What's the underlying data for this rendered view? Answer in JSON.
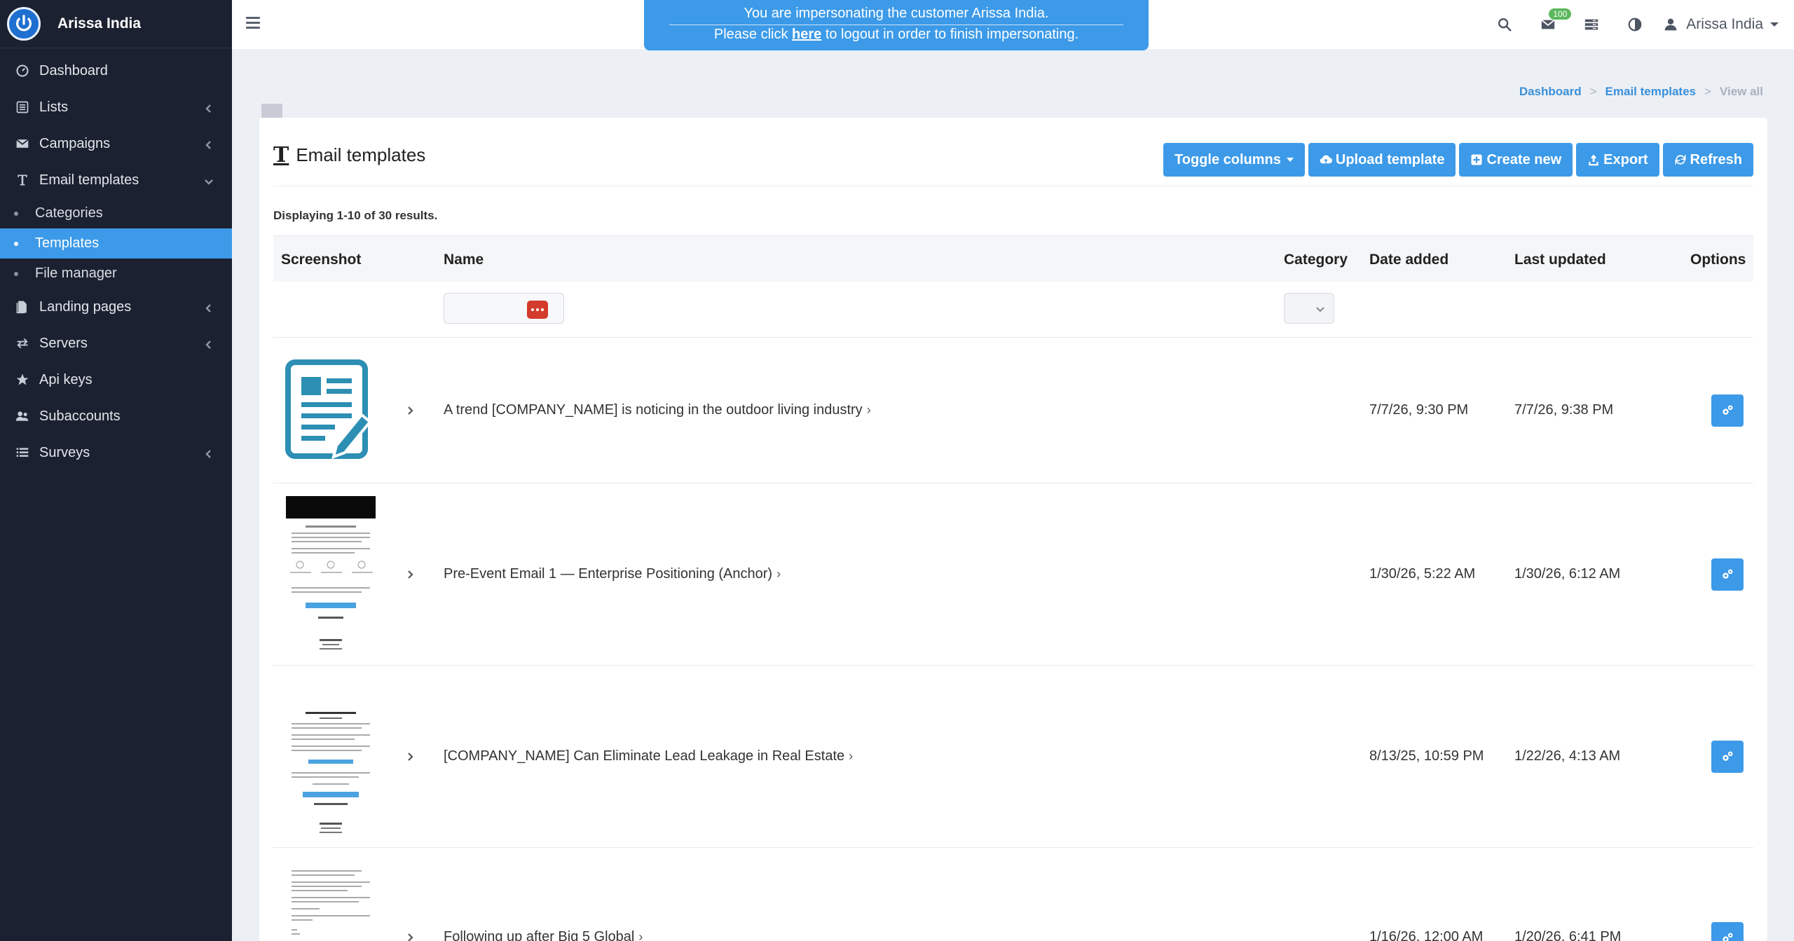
{
  "app": {
    "brand_name": "Arissa India"
  },
  "sidebar": {
    "items": [
      {
        "label": "Dashboard",
        "icon": "dashboard-icon"
      },
      {
        "label": "Lists",
        "icon": "list-icon"
      },
      {
        "label": "Campaigns",
        "icon": "envelope-icon"
      },
      {
        "label": "Email templates",
        "icon": "text-icon"
      },
      {
        "label": "Landing pages",
        "icon": "pages-icon"
      },
      {
        "label": "Servers",
        "icon": "exchange-icon"
      },
      {
        "label": "Api keys",
        "icon": "star-icon"
      },
      {
        "label": "Subaccounts",
        "icon": "users-icon"
      },
      {
        "label": "Surveys",
        "icon": "list-icon"
      }
    ],
    "sub_items": [
      {
        "label": "Categories"
      },
      {
        "label": "Templates",
        "active": true
      },
      {
        "label": "File manager"
      }
    ]
  },
  "impersonation": {
    "line1": "You are impersonating the customer Arissa India.",
    "line2_before": "Please click ",
    "line2_link": "here",
    "line2_after": " to logout in order to finish impersonating."
  },
  "topbar": {
    "notification_count": "100",
    "user_name": "Arissa India"
  },
  "breadcrumb": {
    "dashboard": "Dashboard",
    "sep": ">",
    "email_templates": "Email templates",
    "current": "View all"
  },
  "page": {
    "title": "Email templates",
    "buttons": {
      "toggle_columns": "Toggle columns",
      "upload_template": "Upload template",
      "create_new": "Create new",
      "export": "Export",
      "refresh": "Refresh"
    },
    "summary": "Displaying 1-10 of 30 results."
  },
  "table": {
    "headers": {
      "screenshot": "Screenshot",
      "name": "Name",
      "category": "Category",
      "date_added": "Date added",
      "last_updated": "Last updated",
      "options": "Options"
    },
    "rows": [
      {
        "name": "A trend [COMPANY_NAME] is noticing in the outdoor living industry",
        "category": "",
        "date_added": "7/7/26, 9:30 PM",
        "last_updated": "7/7/26, 9:38 PM"
      },
      {
        "name": "Pre-Event Email 1 — Enterprise Positioning (Anchor)",
        "category": "",
        "date_added": "1/30/26, 5:22 AM",
        "last_updated": "1/30/26, 6:12 AM"
      },
      {
        "name": "[COMPANY_NAME] Can Eliminate Lead Leakage in Real Estate",
        "category": "",
        "date_added": "8/13/25, 10:59 PM",
        "last_updated": "1/22/26, 4:13 AM"
      },
      {
        "name": "Following up after Big 5 Global",
        "category": "",
        "date_added": "1/16/26, 12:00 AM",
        "last_updated": "1/20/26, 6:41 PM"
      }
    ]
  },
  "colors": {
    "sidebar_bg": "#1b2130",
    "accent": "#3c9ae8",
    "danger": "#d33b2c",
    "badge": "#5cb85c"
  }
}
